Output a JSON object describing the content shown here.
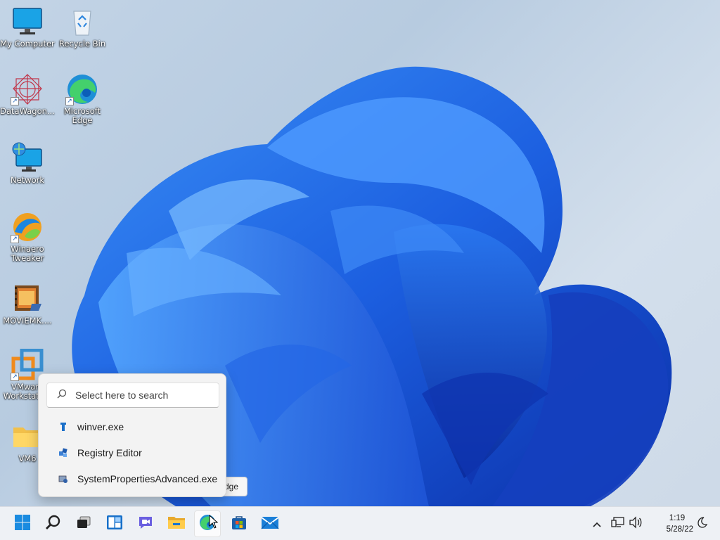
{
  "desktop": {
    "icons": [
      {
        "label": "My Computer",
        "icon": "monitor-icon"
      },
      {
        "label": "Recycle Bin",
        "icon": "recycle-bin-icon"
      },
      {
        "label": "DataWagon...",
        "icon": "datawagon-icon"
      },
      {
        "label": "Microsoft Edge",
        "icon": "edge-icon"
      },
      {
        "label": "Network",
        "icon": "network-icon"
      },
      {
        "label": "Winaero Tweaker",
        "icon": "winaero-tweaker-icon"
      },
      {
        "label": "MOVIEMK....",
        "icon": "movie-maker-icon"
      },
      {
        "label": "VMware Workstation",
        "icon": "vmware-icon"
      },
      {
        "label": "VM6",
        "icon": "folder-icon"
      }
    ]
  },
  "tooltip": {
    "text": "dge"
  },
  "search_popup": {
    "placeholder": "Select here to search",
    "results": [
      {
        "label": "winver.exe",
        "icon": "winver-icon"
      },
      {
        "label": "Registry Editor",
        "icon": "registry-editor-icon"
      },
      {
        "label": "SystemPropertiesAdvanced.exe",
        "icon": "system-properties-icon"
      }
    ]
  },
  "taskbar": {
    "apps": [
      {
        "name": "Start",
        "icon": "windows-start-icon"
      },
      {
        "name": "Search",
        "icon": "search-icon"
      },
      {
        "name": "Task View",
        "icon": "task-view-icon"
      },
      {
        "name": "Widgets",
        "icon": "widgets-icon"
      },
      {
        "name": "Chat",
        "icon": "chat-icon"
      },
      {
        "name": "File Explorer",
        "icon": "file-explorer-icon"
      },
      {
        "name": "Microsoft Edge",
        "icon": "edge-icon"
      },
      {
        "name": "Microsoft Store",
        "icon": "store-icon"
      },
      {
        "name": "Mail",
        "icon": "mail-icon"
      }
    ],
    "clock": {
      "time": "1:19",
      "date": "5/28/22"
    }
  },
  "colors": {
    "accent": "#1a73e8",
    "wallpaper_blue": "#1b63e0",
    "taskbar": "#eef1f5"
  }
}
